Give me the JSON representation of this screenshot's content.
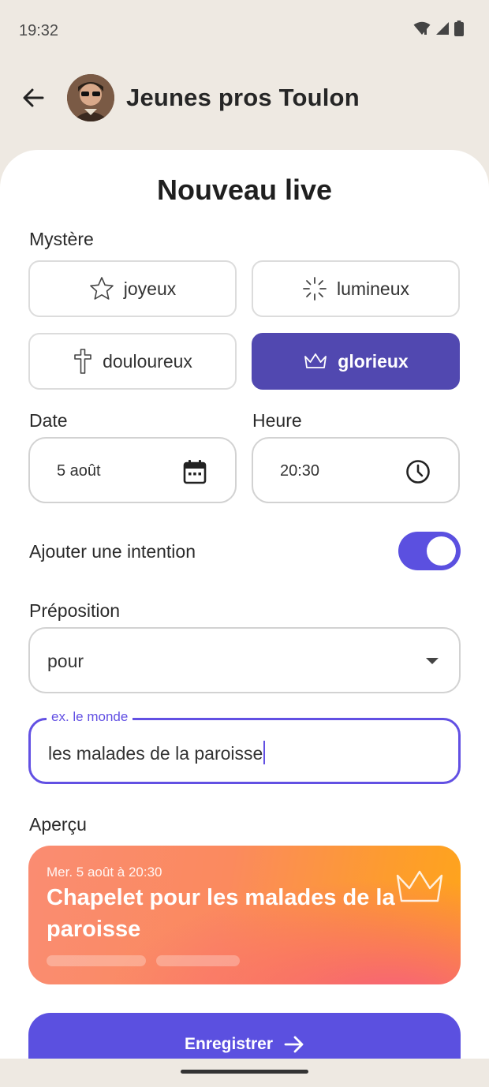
{
  "status_bar": {
    "time": "19:32"
  },
  "header": {
    "group_name": "Jeunes pros Toulon"
  },
  "sheet": {
    "title": "Nouveau live",
    "mystery": {
      "label": "Mystère",
      "options": [
        {
          "label": "joyeux",
          "icon": "star-icon"
        },
        {
          "label": "lumineux",
          "icon": "light-icon"
        },
        {
          "label": "douloureux",
          "icon": "cross-icon"
        },
        {
          "label": "glorieux",
          "icon": "crown-icon",
          "selected": true
        }
      ]
    },
    "date": {
      "label": "Date",
      "value": "5 août"
    },
    "time": {
      "label": "Heure",
      "value": "20:30"
    },
    "intention": {
      "label": "Ajouter une intention",
      "enabled": true
    },
    "preposition": {
      "label": "Préposition",
      "value": "pour"
    },
    "intention_text": {
      "label": "ex. le monde",
      "value": "les malades de la paroisse"
    },
    "preview": {
      "label": "Aperçu",
      "date": "Mer. 5 août à 20:30",
      "title": "Chapelet pour les malades de la paroisse"
    },
    "save_label": "Enregistrer"
  },
  "colors": {
    "primary": "#5B50E0",
    "selected_chip": "#5148B0",
    "background": "#EEE9E2",
    "preview_start": "#FA8C72",
    "preview_end": "#FFA51A"
  }
}
